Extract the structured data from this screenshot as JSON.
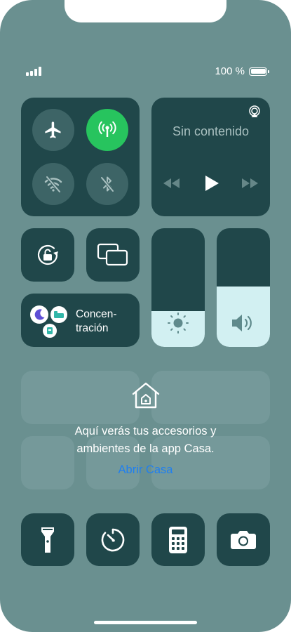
{
  "status": {
    "battery_text": "100 %",
    "battery_level": 1.0,
    "signal_bars": 4
  },
  "connectivity": {
    "airplane": {
      "icon": "airplane-icon",
      "active": false
    },
    "cellular": {
      "icon": "cellular-antenna-icon",
      "active": true,
      "color": "#27c45e"
    },
    "wifi": {
      "icon": "wifi-off-icon",
      "active": false
    },
    "bluetooth": {
      "icon": "bluetooth-off-icon",
      "active": false
    }
  },
  "media": {
    "title": "Sin contenido",
    "airplay_icon": "airplay-icon",
    "controls": [
      "rewind-icon",
      "play-icon",
      "fast-forward-icon"
    ]
  },
  "focus": {
    "label": "Concen-\ntración",
    "icons": [
      "moon-icon",
      "bed-icon",
      "person-badge-icon"
    ]
  },
  "brightness": {
    "level_percent": 30,
    "icon": "sun-icon"
  },
  "volume": {
    "level_percent": 51,
    "icon": "speaker-icon"
  },
  "home": {
    "message_line1": "Aquí verás tus accesorios y",
    "message_line2": "ambientes de la app Casa.",
    "link": "Abrir Casa",
    "icon": "house-icon",
    "link_color": "#1f7ff0"
  },
  "bottom_controls": [
    "flashlight-icon",
    "timer-icon",
    "calculator-icon",
    "camera-icon"
  ],
  "colors": {
    "background": "#6a9090",
    "tile": "#20474a",
    "circle": "#3d6466",
    "slider_fill": "#d2f0f2"
  }
}
